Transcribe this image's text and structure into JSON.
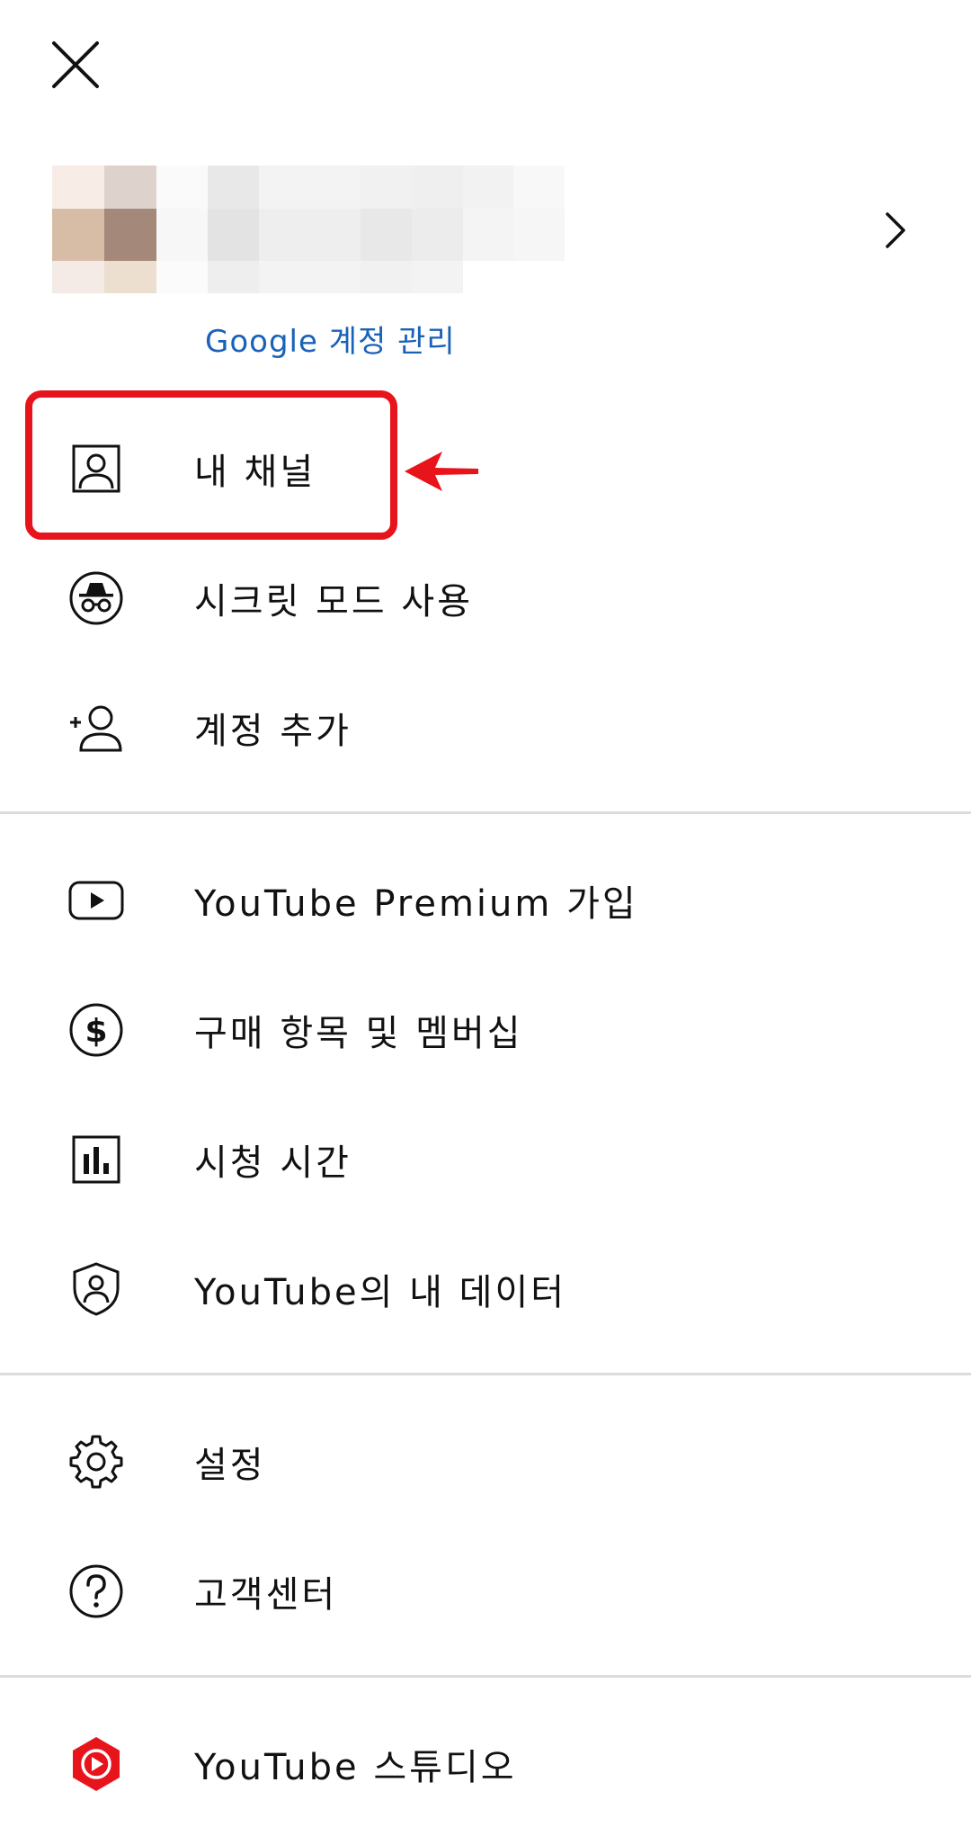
{
  "header": {
    "close_icon": "close-icon",
    "chevron_icon": "chevron-right-icon",
    "manage_account_label": "Google 계정 관리",
    "link_color": "#1a62b8"
  },
  "menu": {
    "section1": [
      {
        "label": "내 채널",
        "icon": "account-box-icon"
      },
      {
        "label": "시크릿 모드 사용",
        "icon": "incognito-icon"
      },
      {
        "label": "계정 추가",
        "icon": "add-account-icon"
      }
    ],
    "section2": [
      {
        "label": "YouTube Premium 가입",
        "icon": "youtube-play-icon"
      },
      {
        "label": "구매 항목 및 멤버십",
        "icon": "dollar-circle-icon"
      },
      {
        "label": "시청 시간",
        "icon": "bar-chart-icon"
      },
      {
        "label": "YouTube의 내 데이터",
        "icon": "shield-user-icon"
      }
    ],
    "section3": [
      {
        "label": "설정",
        "icon": "gear-icon"
      },
      {
        "label": "고객센터",
        "icon": "help-icon"
      }
    ],
    "section4": [
      {
        "label": "YouTube 스튜디오",
        "icon": "youtube-studio-icon"
      }
    ]
  },
  "annotation": {
    "highlight_color": "#e8141c",
    "arrow_icon": "arrow-left-icon"
  },
  "colors": {
    "studio_red": "#e8141c",
    "divider": "#dcdcdc"
  }
}
